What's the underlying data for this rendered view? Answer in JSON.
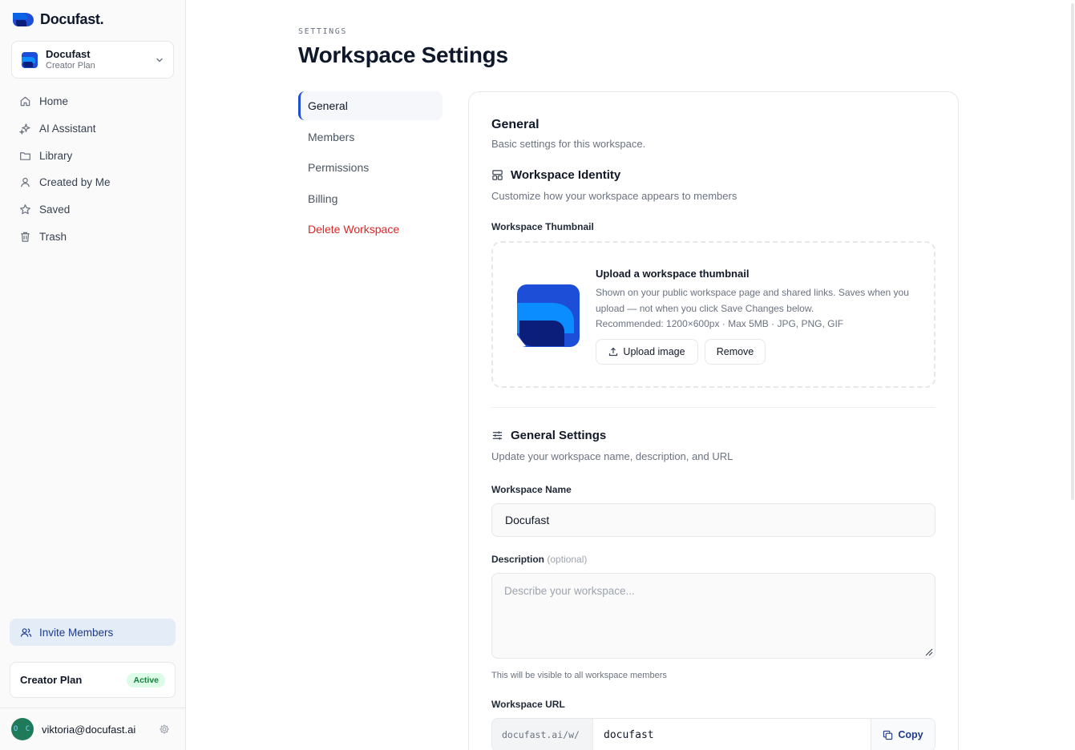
{
  "brand": {
    "name": "Docufast."
  },
  "workspace_switcher": {
    "name": "Docufast",
    "plan": "Creator Plan"
  },
  "sidebar": {
    "items": [
      {
        "label": "Home",
        "icon": "home-icon"
      },
      {
        "label": "AI Assistant",
        "icon": "sparkles-icon"
      },
      {
        "label": "Library",
        "icon": "folder-icon"
      },
      {
        "label": "Created by Me",
        "icon": "user-icon"
      },
      {
        "label": "Saved",
        "icon": "star-icon"
      },
      {
        "label": "Trash",
        "icon": "trash-icon"
      }
    ],
    "invite_label": "Invite Members",
    "plan_label": "Creator Plan",
    "plan_status": "Active",
    "user_initials": "O C",
    "user_email": "viktoria@docufast.ai"
  },
  "page": {
    "eyebrow": "SETTINGS",
    "title": "Workspace Settings"
  },
  "subnav": {
    "items": [
      {
        "label": "General"
      },
      {
        "label": "Members"
      },
      {
        "label": "Permissions"
      },
      {
        "label": "Billing"
      },
      {
        "label": "Delete Workspace"
      }
    ]
  },
  "general": {
    "title": "General",
    "subtitle": "Basic settings for this workspace.",
    "identity": {
      "title": "Workspace Identity",
      "subtitle": "Customize how your workspace appears to members",
      "thumbnail_label": "Workspace Thumbnail",
      "upload_title": "Upload a workspace thumbnail",
      "upload_desc": "Shown on your public workspace page and shared links. Saves when you upload — not when you click Save Changes below.",
      "upload_reco": "Recommended: 1200×600px · Max 5MB · JPG, PNG, GIF",
      "upload_button": "Upload image",
      "remove_button": "Remove"
    },
    "settings": {
      "title": "General Settings",
      "subtitle": "Update your workspace name, description, and URL",
      "name_label": "Workspace Name",
      "name_value": "Docufast",
      "desc_label": "Description",
      "desc_optional": "(optional)",
      "desc_placeholder": "Describe your workspace...",
      "desc_hint": "This will be visible to all workspace members",
      "url_label": "Workspace URL",
      "url_prefix": "docufast.ai/w/",
      "url_slug": "docufast",
      "copy_label": "Copy"
    }
  },
  "colors": {
    "accent": "#1d4ed8",
    "danger": "#dc2626",
    "success": "#15803d"
  }
}
